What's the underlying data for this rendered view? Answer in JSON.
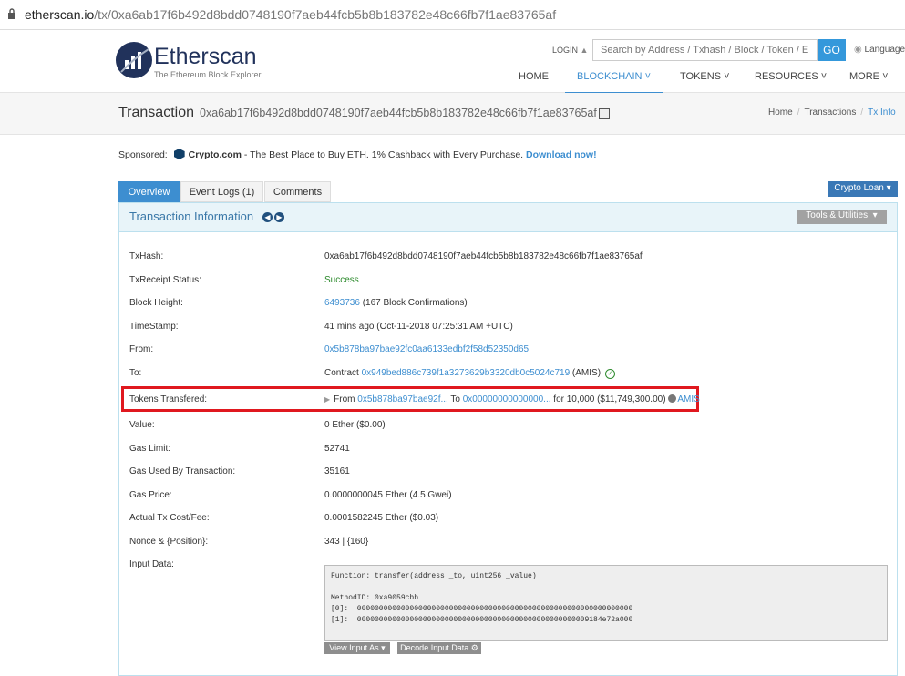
{
  "browser": {
    "url_host": "etherscan.io",
    "url_path": "/tx/0xa6ab17f6b492d8bdd0748190f7aeb44fcb5b8b183782e48c66fb7f1ae83765af"
  },
  "header": {
    "logo_title": "Etherscan",
    "logo_subtitle": "The Ethereum Block Explorer",
    "login_label": "LOGIN",
    "search_placeholder": "Search by Address / Txhash / Block / Token / Ens",
    "go_label": "GO",
    "language_label": "Language",
    "nav": [
      "HOME",
      "BLOCKCHAIN",
      "TOKENS",
      "RESOURCES",
      "MORE"
    ]
  },
  "subheader": {
    "title": "Transaction",
    "hash": "0xa6ab17f6b492d8bdd0748190f7aeb44fcb5b8b183782e48c66fb7f1ae83765af",
    "breadcrumb": [
      "Home",
      "Transactions",
      "Tx Info"
    ]
  },
  "sponsored": {
    "label": "Sponsored:",
    "brand": "Crypto.com",
    "text": " - The Best Place to Buy ETH. 1% Cashback with Every Purchase. ",
    "link": "Download now!"
  },
  "tabs": [
    "Overview",
    "Event Logs (1)",
    "Comments"
  ],
  "crypto_loan_label": "Crypto Loan",
  "panel": {
    "title": "Transaction Information",
    "tools_label": "Tools & Utilities"
  },
  "details": {
    "txhash_label": "TxHash:",
    "txhash": "0xa6ab17f6b492d8bdd0748190f7aeb44fcb5b8b183782e48c66fb7f1ae83765af",
    "status_label": "TxReceipt Status:",
    "status": "Success",
    "block_label": "Block Height:",
    "block": "6493736",
    "block_confirm": " (167 Block Confirmations)",
    "timestamp_label": "TimeStamp:",
    "timestamp": "41 mins ago (Oct-11-2018 07:25:31 AM +UTC)",
    "from_label": "From:",
    "from": "0x5b878ba97bae92fc0aa6133edbf2f58d52350d65",
    "to_label": "To:",
    "to_prefix": "Contract ",
    "to": "0x949bed886c739f1a3273629b3320db0c5024c719",
    "to_suffix": " (AMIS)",
    "tokens_label": "Tokens Transfered:",
    "tokens_from_prefix": "From ",
    "tokens_from": "0x5b878ba97bae92f...",
    "tokens_to_prefix": " To ",
    "tokens_to": "0x00000000000000...",
    "tokens_amount": "  for  10,000 ($11,749,300.00)",
    "tokens_symbol": "AMIS",
    "value_label": "Value:",
    "value": "0 Ether ($0.00)",
    "gas_limit_label": "Gas Limit:",
    "gas_limit": "52741",
    "gas_used_label": "Gas Used By Transaction:",
    "gas_used": "35161",
    "gas_price_label": "Gas Price:",
    "gas_price": "0.0000000045 Ether (4.5 Gwei)",
    "fee_label": "Actual Tx Cost/Fee:",
    "fee": "0.0001582245 Ether ($0.03)",
    "nonce_label": "Nonce & {Position}:",
    "nonce": "343 | {160}",
    "input_label": "Input Data:",
    "input_data": "Function: transfer(address _to, uint256 _value)\n\nMethodID: 0xa9059cbb\n[0]:  000000000000000000000000000000000000000000000000000000000000000\n[1]:  00000000000000000000000000000000000000000000000000009184e72a000",
    "view_input_label": "View Input As",
    "decode_label": "Decode Input Data"
  }
}
